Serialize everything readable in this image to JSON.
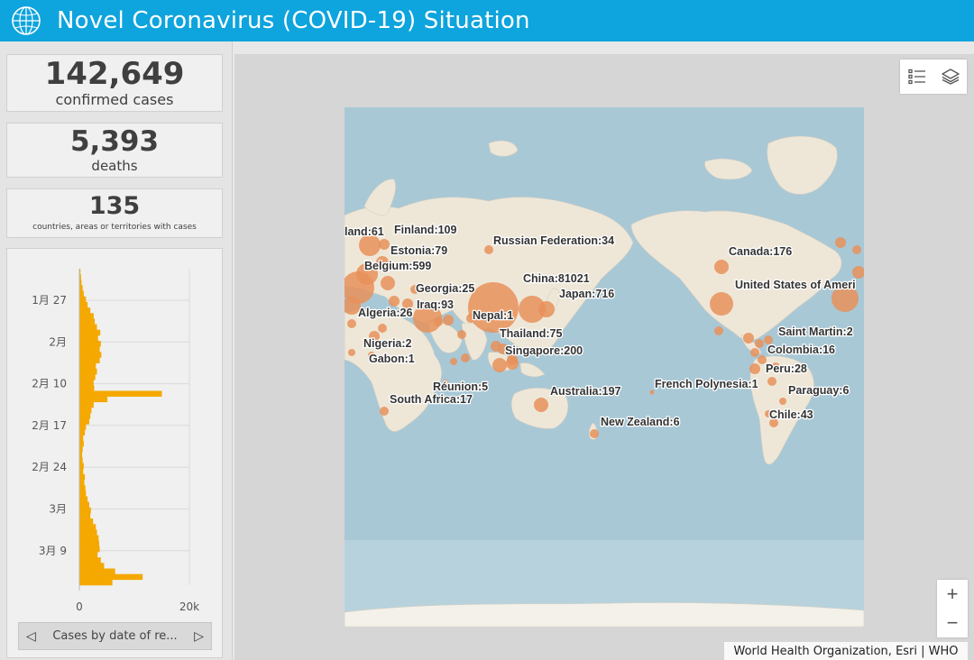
{
  "header": {
    "title": "Novel Coronavirus (COVID-19) Situation",
    "logo_icon": "who-emblem-icon"
  },
  "stats": {
    "confirmed": {
      "value": "142,649",
      "label": "confirmed cases"
    },
    "deaths": {
      "value": "5,393",
      "label": "deaths"
    },
    "countries": {
      "value": "135",
      "label": "countries, areas or territories with cases"
    }
  },
  "chart_data": {
    "type": "bar",
    "orientation": "horizontal",
    "series_color": "#f5a800",
    "ytick_labels": [
      "1月 27",
      "2月",
      "2月 10",
      "2月 17",
      "2月 24",
      "3月",
      "3月 9"
    ],
    "xtick_labels": [
      "0",
      "20k"
    ],
    "xlim": [
      0,
      20000
    ],
    "daily_values": [
      200,
      300,
      400,
      600,
      800,
      1200,
      1500,
      2000,
      2600,
      2800,
      3200,
      3800,
      3400,
      3900,
      3700,
      4000,
      3700,
      3000,
      3200,
      2900,
      2600,
      2700,
      15000,
      5100,
      2600,
      2200,
      2000,
      1800,
      1200,
      1000,
      700,
      800,
      600,
      500,
      600,
      800,
      700,
      1000,
      900,
      1100,
      1200,
      1500,
      1800,
      2100,
      2000,
      2500,
      3000,
      3200,
      3500,
      3600,
      3700,
      3300,
      3900,
      4500,
      6500,
      11500,
      6000
    ]
  },
  "chart_nav": {
    "label": "Cases by date of re...",
    "prev_icon": "chevron-left-icon",
    "next_icon": "chevron-right-icon"
  },
  "map": {
    "labels": {
      "finland": "Finland:109",
      "iceland": "land:61",
      "estonia": "Estonia:79",
      "belgium": "Belgium:599",
      "russia": "Russian Federation:34",
      "china": "China:81021",
      "japan": "Japan:716",
      "georgia": "Georgia:25",
      "iraq": "Iraq:93",
      "algeria": "Algeria:26",
      "nepal": "Nepal:1",
      "thailand": "Thailand:75",
      "nigeria": "Nigeria:2",
      "singapore": "Singapore:200",
      "gabon": "Gabon:1",
      "reunion": "Réunion:5",
      "south_africa": "South Africa:17",
      "australia": "Australia:197",
      "new_zealand": "New Zealand:6",
      "french_polynesia": "French Polynesia:1",
      "canada": "Canada:176",
      "usa": "United States of Ameri",
      "saint_martin": "Saint Martin:2",
      "colombia": "Colombia:16",
      "peru": "Peru:28",
      "paraguay": "Paraguay:6",
      "chile": "Chile:43"
    },
    "bubble_color": "#e8905a",
    "ocean_color": "#a9c8d6",
    "land_color": "#eee7d8"
  },
  "map_tools": {
    "legend_icon": "legend-list-icon",
    "layers_icon": "layers-icon"
  },
  "zoom": {
    "in": "+",
    "out": "−"
  },
  "attribution": "World Health Organization, Esri | WHO"
}
